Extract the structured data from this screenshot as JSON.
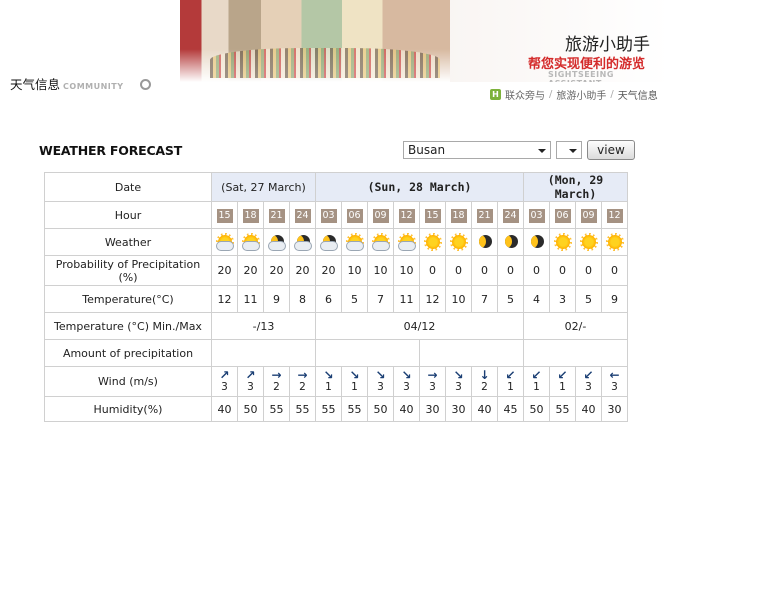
{
  "banner": {
    "title": "旅游小助手",
    "subtitle": "帮您实现便利的游览",
    "en": "SIGHTSEEING ASSISTANT"
  },
  "page_header": {
    "title": "天气信息",
    "sub": "COMMUNITY"
  },
  "breadcrumb": {
    "items": [
      "联众旁与",
      "旅游小助手",
      "天气信息"
    ],
    "sep": "/"
  },
  "forecast": {
    "title": "WEATHER FORECAST",
    "city": "Busan",
    "view_label": "view"
  },
  "table": {
    "labels": {
      "date": "Date",
      "hour": "Hour",
      "weather": "Weather",
      "precip_prob": "Probability of Precipitation (%)",
      "temp": "Temperature(°C)",
      "minmax": "Temperature (°C) Min./Max",
      "amount": "Amount of precipitation",
      "wind": "Wind (m/s)",
      "humidity": "Humidity(%)"
    },
    "days": [
      {
        "label": "(Sat, 27 March)",
        "span": 4,
        "minmax": "-/13"
      },
      {
        "label": "(Sun, 28 March)",
        "span": 8,
        "minmax": "04/12"
      },
      {
        "label": "(Mon, 29 March)",
        "span": 4,
        "minmax": "02/-"
      }
    ],
    "hours": [
      "15",
      "18",
      "21",
      "24",
      "03",
      "06",
      "09",
      "12",
      "15",
      "18",
      "21",
      "24",
      "03",
      "06",
      "09",
      "12"
    ],
    "weather_icons": [
      "sun-cloud-icon",
      "sun-cloud-icon",
      "night-cloud-icon",
      "night-cloud-icon",
      "night-cloud-icon",
      "sun-cloud-icon",
      "sun-cloud-icon",
      "sun-cloud-icon",
      "sun-icon",
      "sun-icon",
      "moon-icon",
      "moon-icon",
      "moon-icon",
      "sun-icon",
      "sun-icon",
      "sun-icon"
    ],
    "precip_prob": [
      "20",
      "20",
      "20",
      "20",
      "20",
      "10",
      "10",
      "10",
      "0",
      "0",
      "0",
      "0",
      "0",
      "0",
      "0",
      "0"
    ],
    "temperature": [
      "12",
      "11",
      "9",
      "8",
      "6",
      "5",
      "7",
      "11",
      "12",
      "10",
      "7",
      "5",
      "4",
      "3",
      "5",
      "9"
    ],
    "wind_dir": [
      "↗",
      "↗",
      "→",
      "→",
      "↘",
      "↘",
      "↘",
      "↘",
      "→",
      "↘",
      "↓",
      "↙",
      "↙",
      "↙",
      "↙",
      "←"
    ],
    "wind_speed": [
      "3",
      "3",
      "2",
      "2",
      "1",
      "1",
      "3",
      "3",
      "3",
      "3",
      "2",
      "1",
      "1",
      "1",
      "3",
      "3"
    ],
    "humidity": [
      "40",
      "50",
      "55",
      "55",
      "55",
      "55",
      "50",
      "40",
      "30",
      "30",
      "40",
      "45",
      "50",
      "55",
      "40",
      "30"
    ]
  }
}
